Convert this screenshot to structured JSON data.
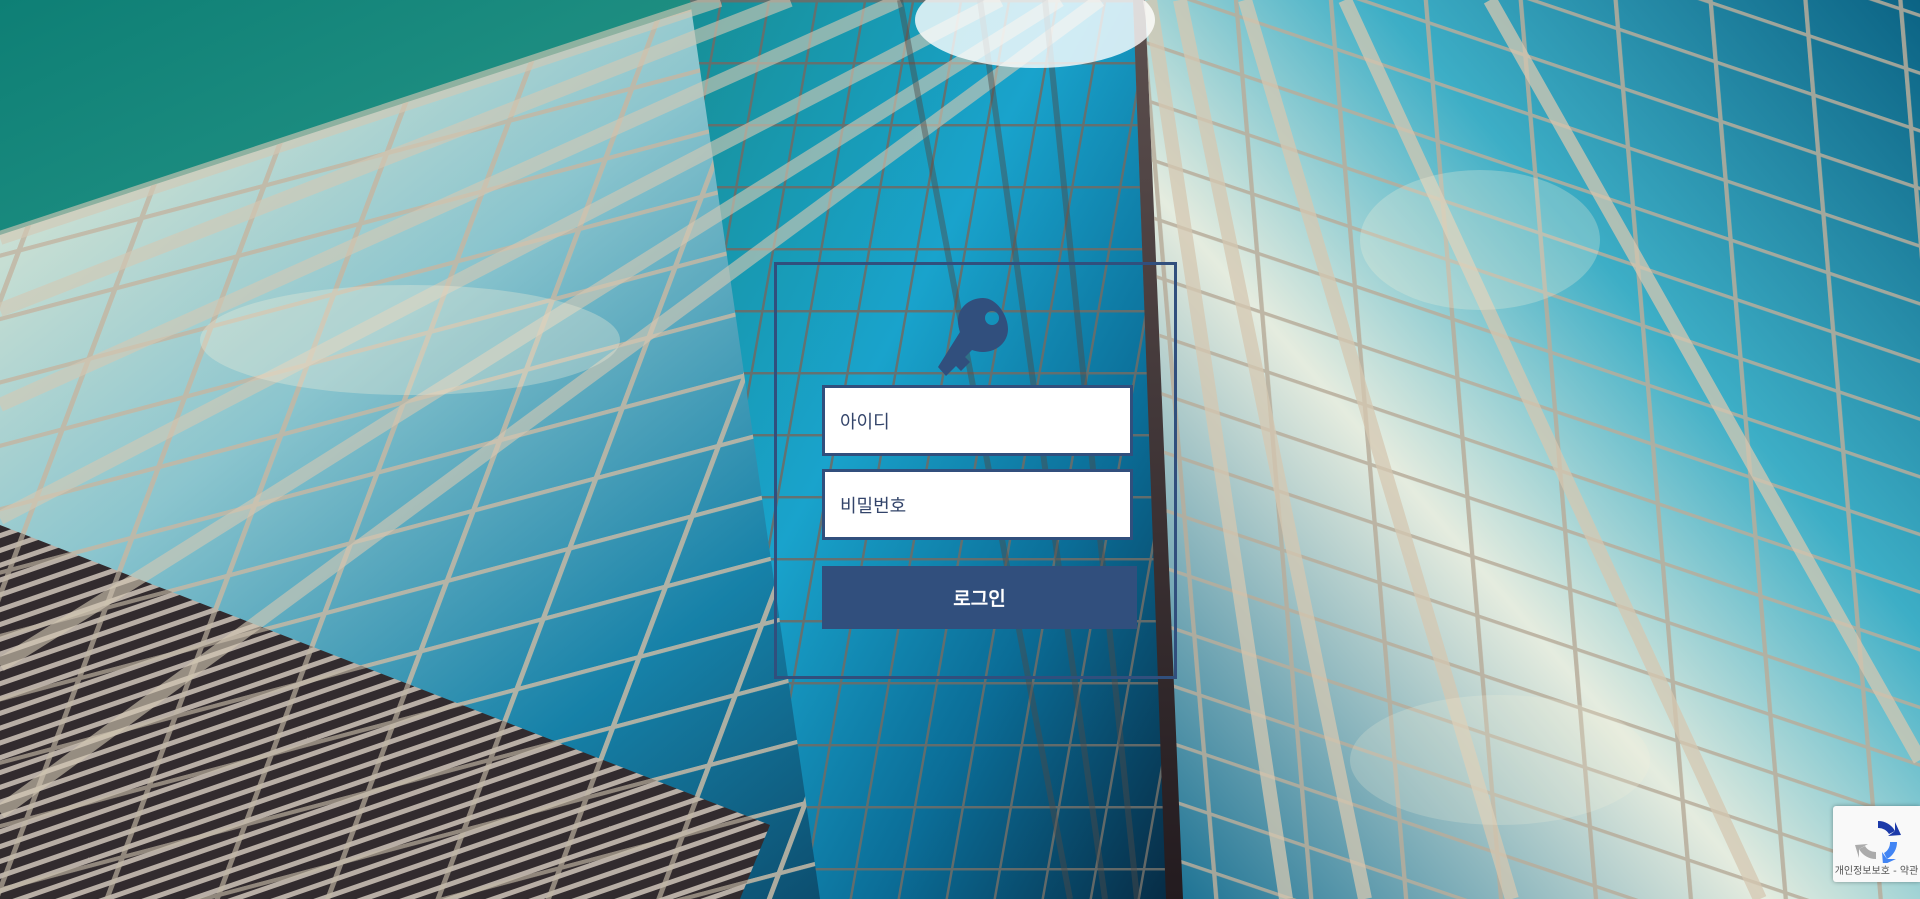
{
  "login": {
    "username_placeholder": "아이디",
    "password_placeholder": "비밀번호",
    "submit_label": "로그인"
  },
  "icons": {
    "login_icon": "key-icon",
    "recaptcha_icon": "recaptcha-icon"
  },
  "colors": {
    "accent": "#314f7d",
    "field_background": "#ffffff",
    "button_text": "#ffffff",
    "recaptcha_background": "#f9f9f9"
  },
  "recaptcha": {
    "privacy_link": "개인정보보호",
    "separator": " - ",
    "terms_link": "약관"
  }
}
